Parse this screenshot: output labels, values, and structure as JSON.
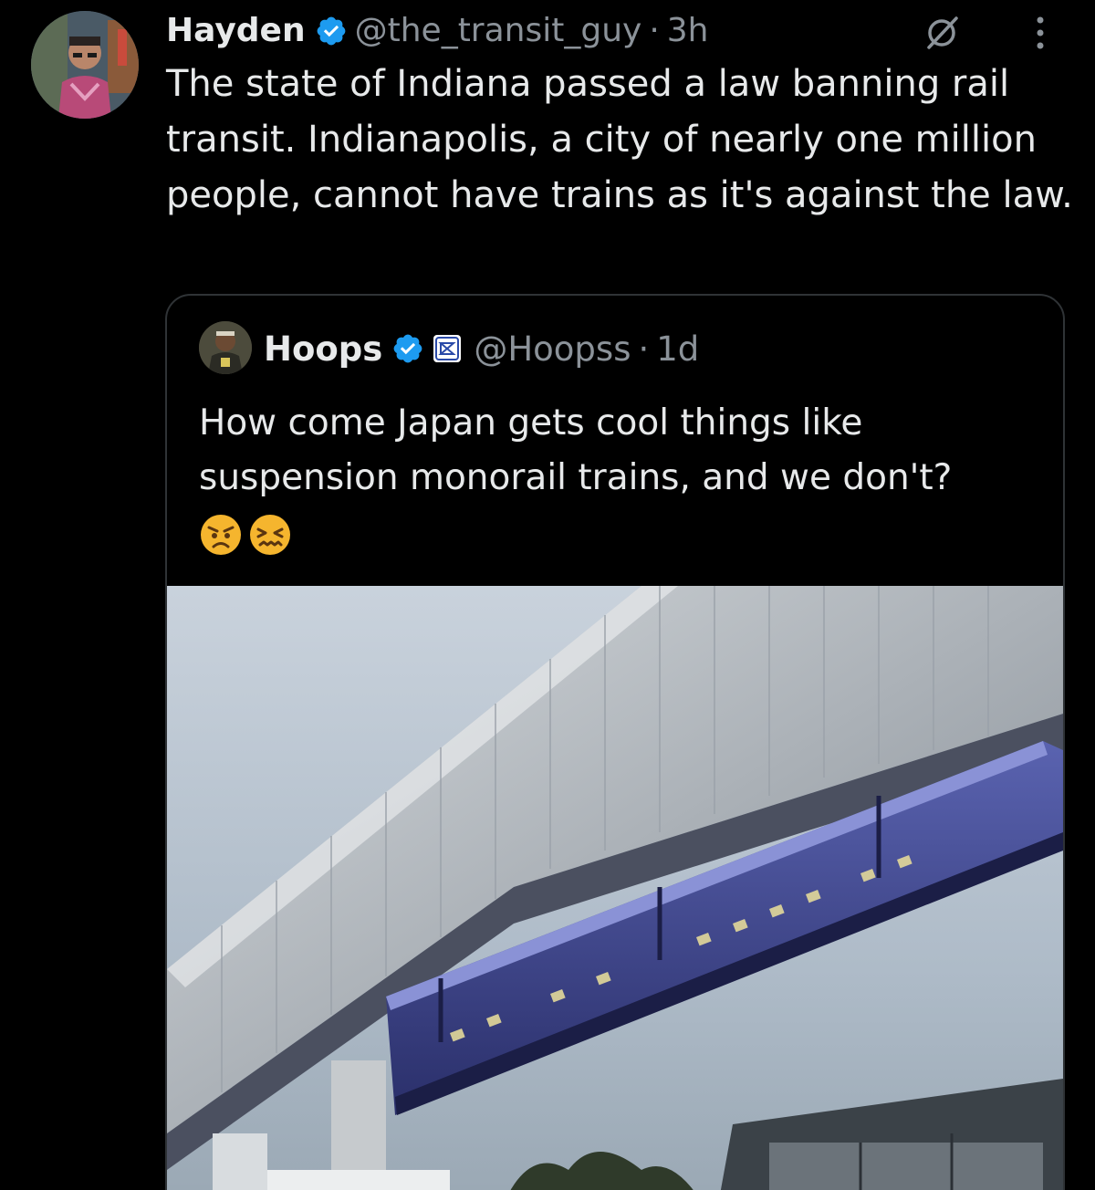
{
  "tweet": {
    "author_name": "Hayden",
    "handle": "@the_transit_guy",
    "separator": "·",
    "time": "3h",
    "text": "The state of Indiana passed a law banning rail transit. Indianapolis, a city of nearly one million people, cannot have trains as it's against the law."
  },
  "quoted_tweet": {
    "author_name": "Hoops",
    "handle": "@Hoopss",
    "separator": "·",
    "time": "1d",
    "text": "How come Japan gets cool things like suspension monorail trains, and we don't?",
    "emojis": [
      "angry-face-emoji",
      "confounded-face-emoji"
    ]
  },
  "colors": {
    "background": "#000000",
    "text_primary": "#e7e9ea",
    "text_secondary": "#8b9299",
    "verified_blue": "#1d9bf0",
    "border": "#2f3336"
  },
  "icons": [
    "verified-badge-icon",
    "grok-icon",
    "more-options-icon",
    "affiliate-badge-icon"
  ]
}
